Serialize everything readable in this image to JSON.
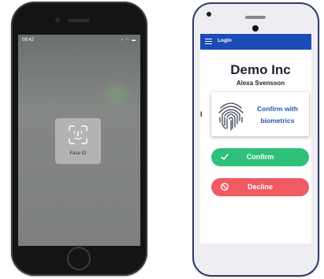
{
  "iphone": {
    "status_time": "09:42",
    "status_icons": "▪ ◠ ▬",
    "faceid": {
      "label": "Face ID",
      "icon": "face-id-icon"
    }
  },
  "android": {
    "topbar": {
      "title": "Login",
      "menu_icon": "menu-icon"
    },
    "company": "Demo Inc",
    "user": "Alexa Svensson",
    "stub": "I",
    "biometrics": {
      "label_line1": "Confirm with",
      "label_line2": "biometrics",
      "icon": "fingerprint-icon"
    },
    "confirm_button": {
      "label": "Confirm",
      "icon": "check-icon"
    },
    "decline_button": {
      "label": "Decline",
      "icon": "cancel-icon"
    }
  },
  "colors": {
    "topbar": "#1b4bb6",
    "confirm": "#2fc07a",
    "decline": "#f05a62",
    "biometrics_text": "#1f58b8"
  }
}
